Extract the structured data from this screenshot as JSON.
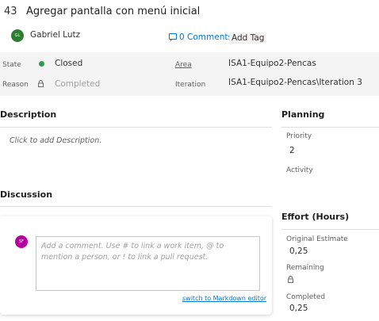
{
  "work_item": {
    "id": "43",
    "title": "Agregar pantalla con menú inicial",
    "owner_initials": "GL",
    "owner_name": "Gabriel Lutz",
    "comments_label": "0 Comments",
    "add_tag_label": "Add Tag"
  },
  "fields": {
    "state_label": "State",
    "state_value": "Closed",
    "reason_label": "Reason",
    "reason_value": "Completed",
    "area_label": "Area",
    "area_value": "ISA1-Equipo2-Pencas",
    "iteration_label": "Iteration",
    "iteration_value": "ISA1-Equipo2-Pencas\\Iteration 3"
  },
  "description": {
    "title": "Description",
    "placeholder": "Click to add Description."
  },
  "discussion": {
    "title": "Discussion",
    "user_initials": "SF",
    "comment_placeholder": "Add a comment. Use # to link a work item, @ to mention a person, or ! to link a pull request.",
    "markdown_link": "switch to Markdown editor"
  },
  "planning": {
    "title": "Planning",
    "priority_label": "Priority",
    "priority_value": "2",
    "activity_label": "Activity",
    "activity_value": ""
  },
  "effort": {
    "title": "Effort (Hours)",
    "original_label": "Original Estimate",
    "original_value": "0,25",
    "remaining_label": "Remaining",
    "completed_label": "Completed",
    "completed_value": "0,25"
  },
  "colors": {
    "state_closed": "#2e9a4c",
    "link": "#0078d4",
    "owner_avatar": "#2e7d32",
    "user_avatar": "#b4009e"
  }
}
